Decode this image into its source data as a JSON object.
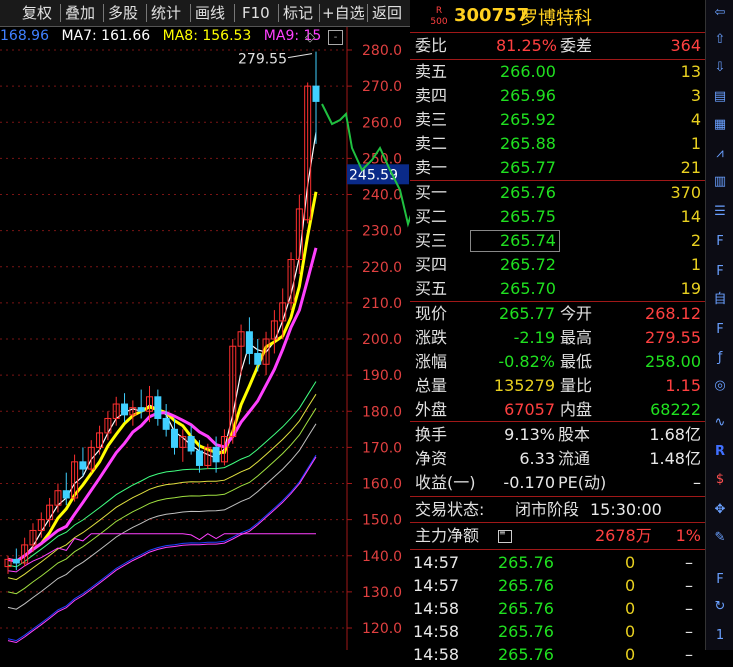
{
  "toolbar": {
    "fuquan": "复权",
    "diejia": "叠加",
    "duogu": "多股",
    "tongji": "统计",
    "huaxian": "画线",
    "f10": "F10",
    "biaoji": "标记",
    "zixuan": "+自选",
    "fanhui": "返回"
  },
  "ma_legend": {
    "cut": "168.96",
    "ma7": "MA7: 161.66",
    "ma8": "MA8: 156.53",
    "ma9": "MA9: 15",
    "ma7_color": "#ffffff",
    "ma8_color": "#ffff00",
    "ma9_color": "#ff40ff"
  },
  "chart_data": {
    "type": "candlestick",
    "y_ticks": [
      "280.0",
      "270.0",
      "260.0",
      "250.0",
      "240.0",
      "230.0",
      "220.0",
      "210.0",
      "200.0",
      "190.0",
      "180.0",
      "170.0",
      "160.0",
      "150.0",
      "140.0",
      "130.0",
      "120.0"
    ],
    "ylim": [
      118,
      285
    ],
    "high_label": "279.55",
    "current_price_label": "245.59",
    "candles": [
      {
        "o": 137,
        "h": 140,
        "l": 135,
        "c": 139
      },
      {
        "o": 139,
        "h": 142,
        "l": 136,
        "c": 138
      },
      {
        "o": 138,
        "h": 145,
        "l": 137,
        "c": 143
      },
      {
        "o": 143,
        "h": 149,
        "l": 141,
        "c": 147
      },
      {
        "o": 147,
        "h": 152,
        "l": 145,
        "c": 150
      },
      {
        "o": 150,
        "h": 156,
        "l": 148,
        "c": 154
      },
      {
        "o": 154,
        "h": 160,
        "l": 152,
        "c": 158
      },
      {
        "o": 158,
        "h": 163,
        "l": 154,
        "c": 156
      },
      {
        "o": 156,
        "h": 168,
        "l": 155,
        "c": 166
      },
      {
        "o": 166,
        "h": 170,
        "l": 162,
        "c": 164
      },
      {
        "o": 164,
        "h": 172,
        "l": 163,
        "c": 170
      },
      {
        "o": 170,
        "h": 176,
        "l": 168,
        "c": 174
      },
      {
        "o": 174,
        "h": 180,
        "l": 172,
        "c": 178
      },
      {
        "o": 178,
        "h": 184,
        "l": 176,
        "c": 182
      },
      {
        "o": 182,
        "h": 185,
        "l": 177,
        "c": 179
      },
      {
        "o": 179,
        "h": 183,
        "l": 176,
        "c": 181
      },
      {
        "o": 181,
        "h": 186,
        "l": 178,
        "c": 180
      },
      {
        "o": 180,
        "h": 187,
        "l": 177,
        "c": 184
      },
      {
        "o": 184,
        "h": 186,
        "l": 176,
        "c": 178
      },
      {
        "o": 178,
        "h": 182,
        "l": 173,
        "c": 175
      },
      {
        "o": 175,
        "h": 178,
        "l": 168,
        "c": 170
      },
      {
        "o": 170,
        "h": 175,
        "l": 166,
        "c": 173
      },
      {
        "o": 173,
        "h": 176,
        "l": 168,
        "c": 169
      },
      {
        "o": 169,
        "h": 172,
        "l": 163,
        "c": 165
      },
      {
        "o": 165,
        "h": 171,
        "l": 164,
        "c": 170
      },
      {
        "o": 170,
        "h": 173,
        "l": 163,
        "c": 166
      },
      {
        "o": 166,
        "h": 175,
        "l": 165,
        "c": 173
      },
      {
        "o": 173,
        "h": 200,
        "l": 171,
        "c": 198
      },
      {
        "o": 198,
        "h": 204,
        "l": 190,
        "c": 202
      },
      {
        "o": 202,
        "h": 206,
        "l": 193,
        "c": 196
      },
      {
        "o": 196,
        "h": 200,
        "l": 191,
        "c": 193
      },
      {
        "o": 193,
        "h": 202,
        "l": 190,
        "c": 200
      },
      {
        "o": 200,
        "h": 208,
        "l": 196,
        "c": 205
      },
      {
        "o": 205,
        "h": 214,
        "l": 200,
        "c": 210
      },
      {
        "o": 210,
        "h": 224,
        "l": 208,
        "c": 222
      },
      {
        "o": 222,
        "h": 240,
        "l": 218,
        "c": 236
      },
      {
        "o": 233,
        "h": 271,
        "l": 232,
        "c": 270
      },
      {
        "o": 270,
        "h": 279.55,
        "l": 254,
        "c": 265.77
      }
    ]
  },
  "panel": {
    "code": "300757",
    "name": "罗博特科",
    "badge_top": "R",
    "badge_bottom": "500",
    "webi_label": "委比",
    "webi_value": "81.25%",
    "weicha_label": "委差",
    "weicha_value": "364",
    "sells": [
      {
        "label": "卖五",
        "price": "266.00",
        "vol": "13"
      },
      {
        "label": "卖四",
        "price": "265.96",
        "vol": "3"
      },
      {
        "label": "卖三",
        "price": "265.92",
        "vol": "4"
      },
      {
        "label": "卖二",
        "price": "265.88",
        "vol": "1"
      },
      {
        "label": "卖一",
        "price": "265.77",
        "vol": "21"
      }
    ],
    "buys": [
      {
        "label": "买一",
        "price": "265.76",
        "vol": "370"
      },
      {
        "label": "买二",
        "price": "265.75",
        "vol": "14"
      },
      {
        "label": "买三",
        "price": "265.74",
        "vol": "2"
      },
      {
        "label": "买四",
        "price": "265.72",
        "vol": "1"
      },
      {
        "label": "买五",
        "price": "265.70",
        "vol": "19"
      }
    ],
    "stats": [
      {
        "l1": "现价",
        "v1": "265.77",
        "c1": "grn",
        "l2": "今开",
        "v2": "268.12",
        "c2": "red"
      },
      {
        "l1": "涨跌",
        "v1": "-2.19",
        "c1": "grn",
        "l2": "最高",
        "v2": "279.55",
        "c2": "red"
      },
      {
        "l1": "涨幅",
        "v1": "-0.82%",
        "c1": "grn",
        "l2": "最低",
        "v2": "258.00",
        "c2": "grn"
      },
      {
        "l1": "总量",
        "v1": "135279",
        "c1": "yel",
        "l2": "量比",
        "v2": "1.15",
        "c2": "red"
      },
      {
        "l1": "外盘",
        "v1": "67057",
        "c1": "red",
        "l2": "内盘",
        "v2": "68222",
        "c2": "grn"
      }
    ],
    "stats2": [
      {
        "l1": "换手",
        "v1": "9.13%",
        "l2": "股本",
        "v2": "1.68亿"
      },
      {
        "l1": "净资",
        "v1": "6.33",
        "l2": "流通",
        "v2": "1.48亿"
      },
      {
        "l1": "收益(一)",
        "v1": "-0.170",
        "l2": "PE(动)",
        "v2": "–"
      }
    ],
    "trade_status_label": "交易状态:",
    "trade_status_value": "闭市阶段",
    "trade_status_time": "15:30:00",
    "net_label": "主力净额",
    "net_value": "2678万",
    "net_pct": "1%",
    "ticks": [
      {
        "time": "14:57",
        "price": "265.76",
        "vol": "0",
        "dir": "–"
      },
      {
        "time": "14:57",
        "price": "265.76",
        "vol": "0",
        "dir": "–"
      },
      {
        "time": "14:58",
        "price": "265.76",
        "vol": "0",
        "dir": "–"
      },
      {
        "time": "14:58",
        "price": "265.76",
        "vol": "0",
        "dir": "–"
      },
      {
        "time": "14:58",
        "price": "265.76",
        "vol": "0",
        "dir": "–"
      }
    ]
  },
  "side_icons": [
    "arrow-left-icon",
    "arrow-up-icon",
    "arrow-down-icon",
    "notes-icon",
    "grid-icon",
    "line-chart-icon",
    "candle-icon",
    "list-icon",
    "f10-icon",
    "f-icon",
    "zi-icon",
    "f12-icon",
    "fx-icon",
    "circle-icon",
    "wave-icon",
    "rsi-icon",
    "dollar-icon",
    "move-icon",
    "pencil-icon",
    "f5-icon",
    "refresh-icon"
  ],
  "side_page": "1"
}
